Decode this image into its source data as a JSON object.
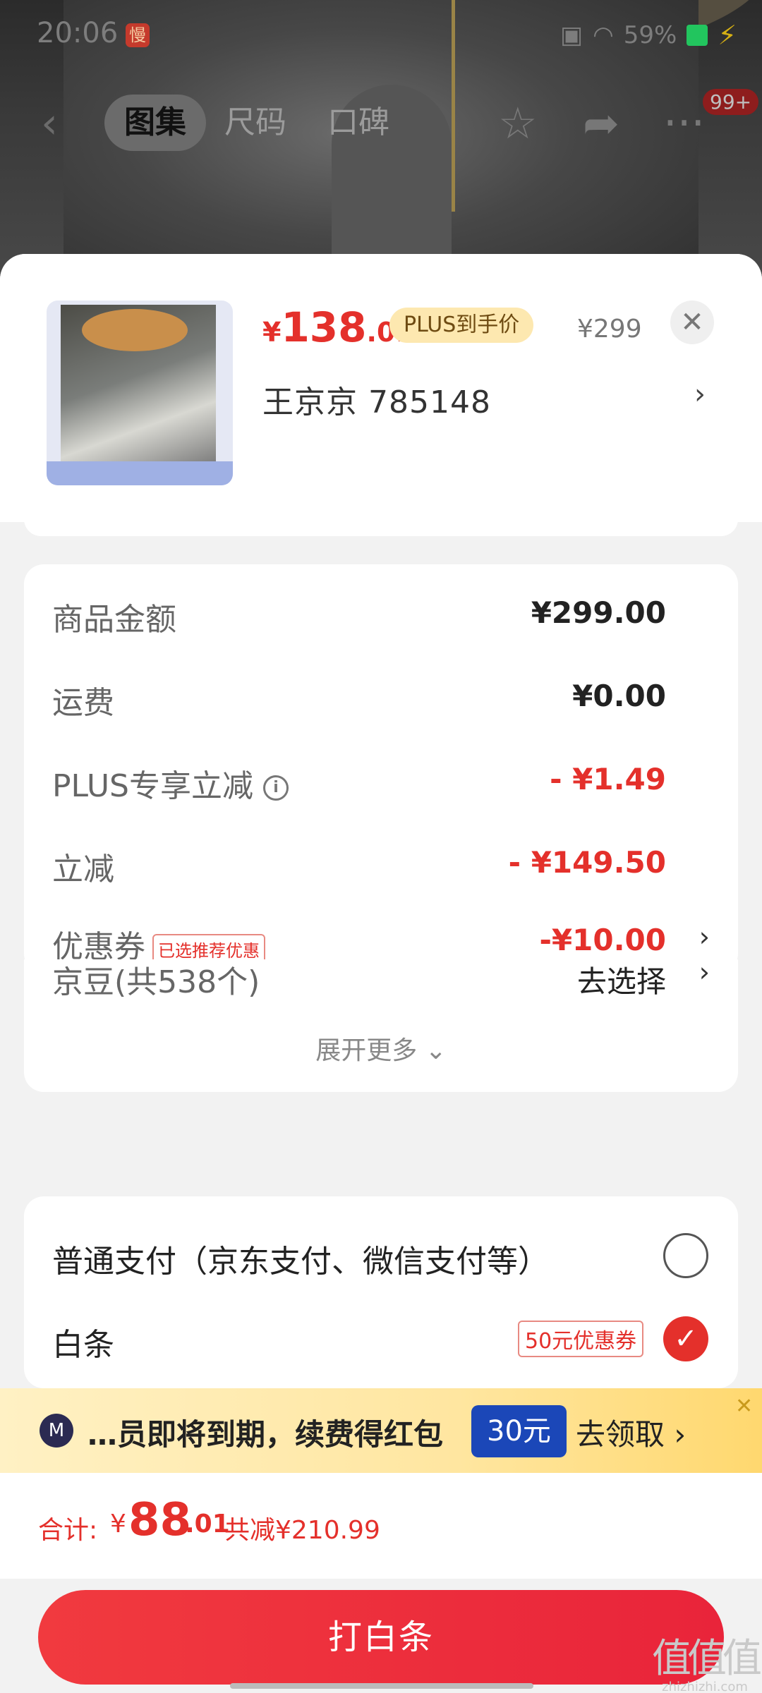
{
  "status_bar": {
    "time": "20:06",
    "app_icon": "慢",
    "battery": "59%"
  },
  "top_nav": {
    "tabs": [
      {
        "label": "图集",
        "active": true
      },
      {
        "label": "尺码"
      },
      {
        "label": "口碑"
      }
    ],
    "badge": "99+",
    "icons": [
      "back-icon",
      "star-icon",
      "share-icon",
      "more-icon"
    ]
  },
  "product": {
    "currency": "¥",
    "price_int": "138",
    "price_dec": ".01",
    "plus_label": "PLUS到手价",
    "original_price": "¥299",
    "spec": "王京京   785148",
    "close": "✕"
  },
  "summary": {
    "rows": [
      {
        "label": "商品金额",
        "value": "¥299.00"
      },
      {
        "label": "运费",
        "value": "¥0.00"
      },
      {
        "label": "PLUS专享立减",
        "value": "- ¥1.49"
      },
      {
        "label": "立减",
        "value": "- ¥149.50"
      },
      {
        "label": "优惠券",
        "tag": "已选推荐优惠",
        "value": "-¥10.00"
      },
      {
        "label": "京豆(共538个)",
        "value": "去选择"
      }
    ],
    "expand_more": "展开更多"
  },
  "payment": {
    "options": [
      {
        "label": "普通支付（京东支付、微信支付等）",
        "selected": false
      },
      {
        "label": "白条",
        "coupon": "50元优惠券",
        "selected": true
      }
    ]
  },
  "promo": {
    "text": "…员即将到期，续费得红包",
    "amount": "30元",
    "action": "去领取"
  },
  "total": {
    "label": "合计:",
    "currency": "¥",
    "int": "88",
    "dec": ".01",
    "saved": "共减¥210.99"
  },
  "pay_button": "打白条",
  "watermark": {
    "big": "值值值",
    "small": "zhizhizhi.com"
  },
  "colors": {
    "accent_red": "#e4302b",
    "plus_gold": "#fde8b0",
    "promo_blue": "#1b47b8"
  }
}
